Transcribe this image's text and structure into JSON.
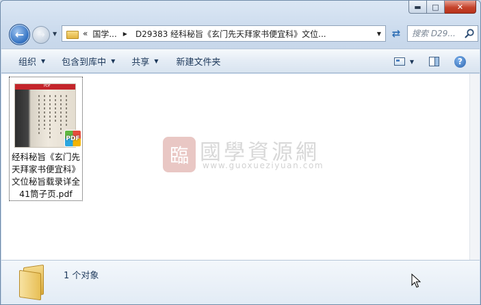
{
  "window": {
    "caption_buttons": {
      "minimize": "▬",
      "maximize": "□",
      "close": "✕"
    }
  },
  "nav": {
    "back_icon": "arrow-left-icon",
    "forward_icon": "arrow-right-icon",
    "breadcrumb": {
      "overflow": "«",
      "items": [
        "国学...",
        "D29383 经科秘旨《玄门先天拜家书便宜科》文位..."
      ],
      "separator": "▶"
    },
    "search_placeholder": "搜索 D29..."
  },
  "toolbar": {
    "items": [
      {
        "label": "组织",
        "has_dropdown": true
      },
      {
        "label": "包含到库中",
        "has_dropdown": true
      },
      {
        "label": "共享",
        "has_dropdown": true
      },
      {
        "label": "新建文件夹",
        "has_dropdown": false
      }
    ]
  },
  "files": [
    {
      "name": "经科秘旨《玄门先天拜家书便宜科》文位秘旨载录详全41筒子页.pdf",
      "thumb_banner": "PDF",
      "badge": "PDF"
    }
  ],
  "watermark": {
    "seal": "臨",
    "title": "國學資源網",
    "url": "www.guoxueziyuan.com"
  },
  "details": {
    "count_text": "1 个对象"
  },
  "colors": {
    "accent": "#2f6fb5",
    "close_button": "#c5432c",
    "toolbar_text": "#1e395b"
  }
}
